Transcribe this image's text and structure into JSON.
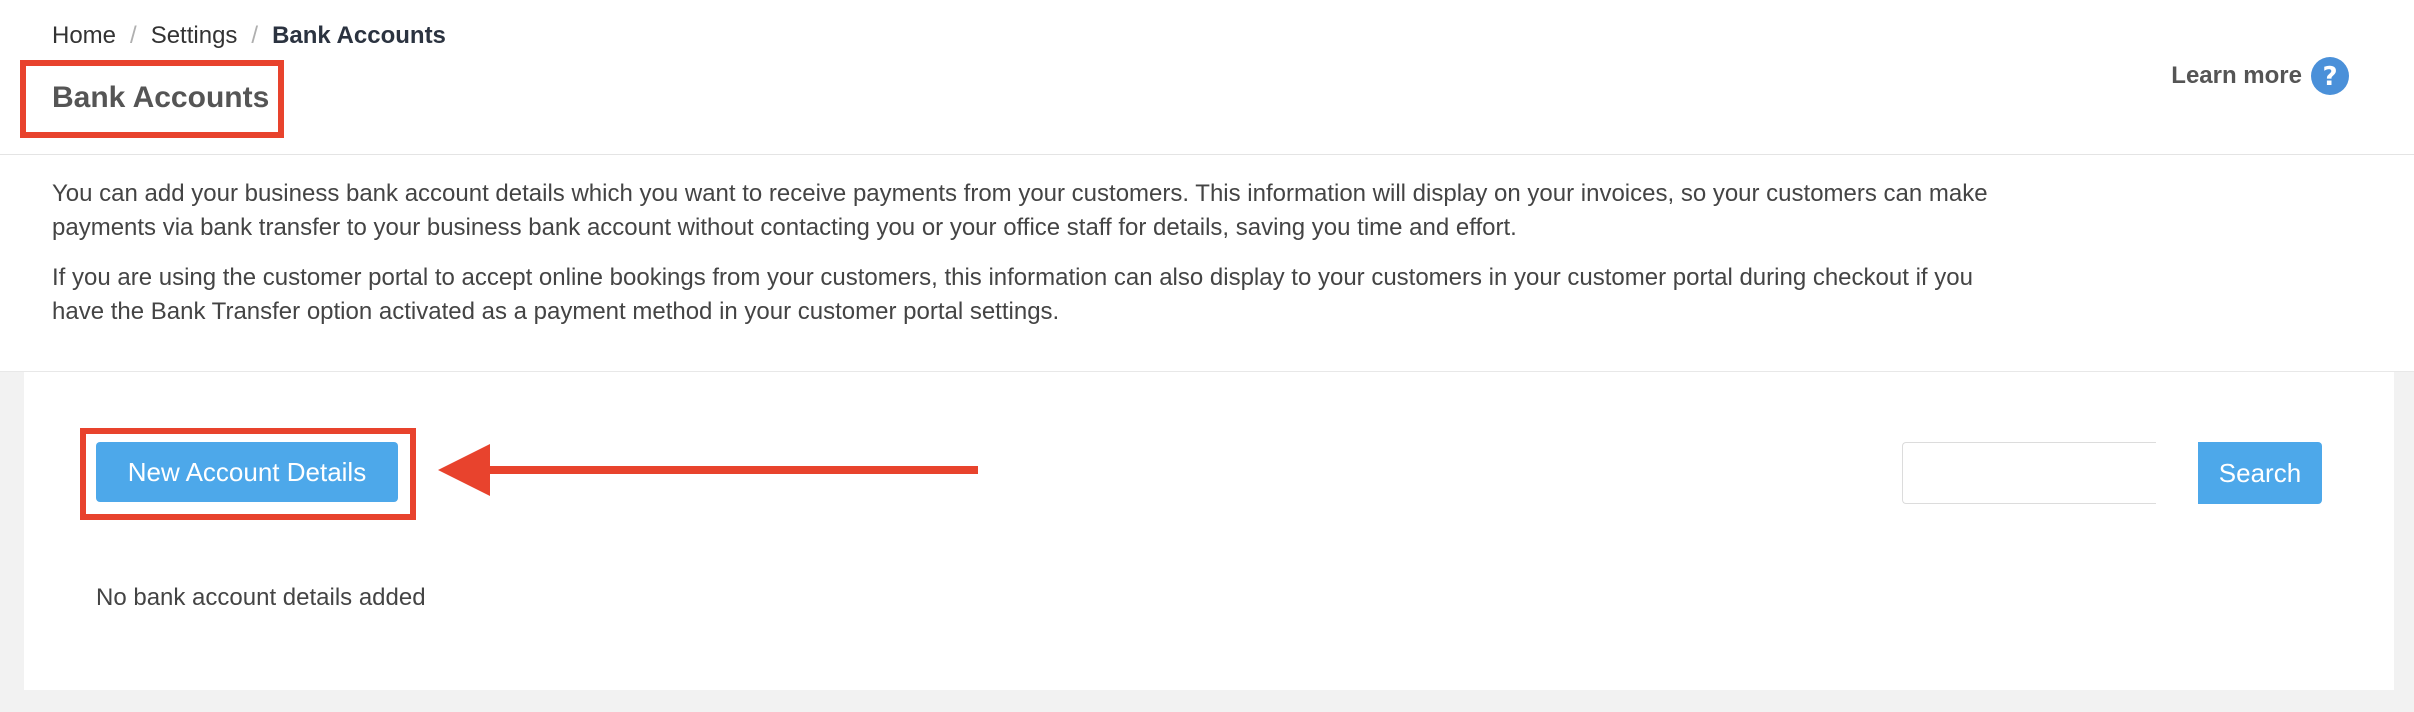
{
  "breadcrumb": {
    "items": [
      "Home",
      "Settings"
    ],
    "separator": "/",
    "current": "Bank Accounts"
  },
  "page": {
    "title": "Bank Accounts"
  },
  "header": {
    "learn_more_label": "Learn more",
    "help_icon": "question-circle-icon"
  },
  "info": {
    "paragraph1": "You can add your business bank account details which you want to receive payments from your customers. This information will display on your invoices, so your customers can make payments via bank transfer to your business bank account without contacting you or your office staff for details, saving you time and effort.",
    "paragraph2": "If you are using the customer portal to accept online bookings from your customers, this information can also display to your customers in your customer portal during checkout if you have the Bank Transfer option activated as a payment method in your customer portal settings."
  },
  "actions": {
    "new_account_label": "New Account Details"
  },
  "search": {
    "value": "",
    "placeholder": "",
    "button_label": "Search"
  },
  "list": {
    "empty_message": "No bank account details added"
  },
  "annotations": {
    "highlight_color": "#e8432d",
    "arrow_icon": "arrow-left-icon"
  },
  "colors": {
    "accent": "#4da8ea",
    "help_icon": "#4a90d9"
  }
}
